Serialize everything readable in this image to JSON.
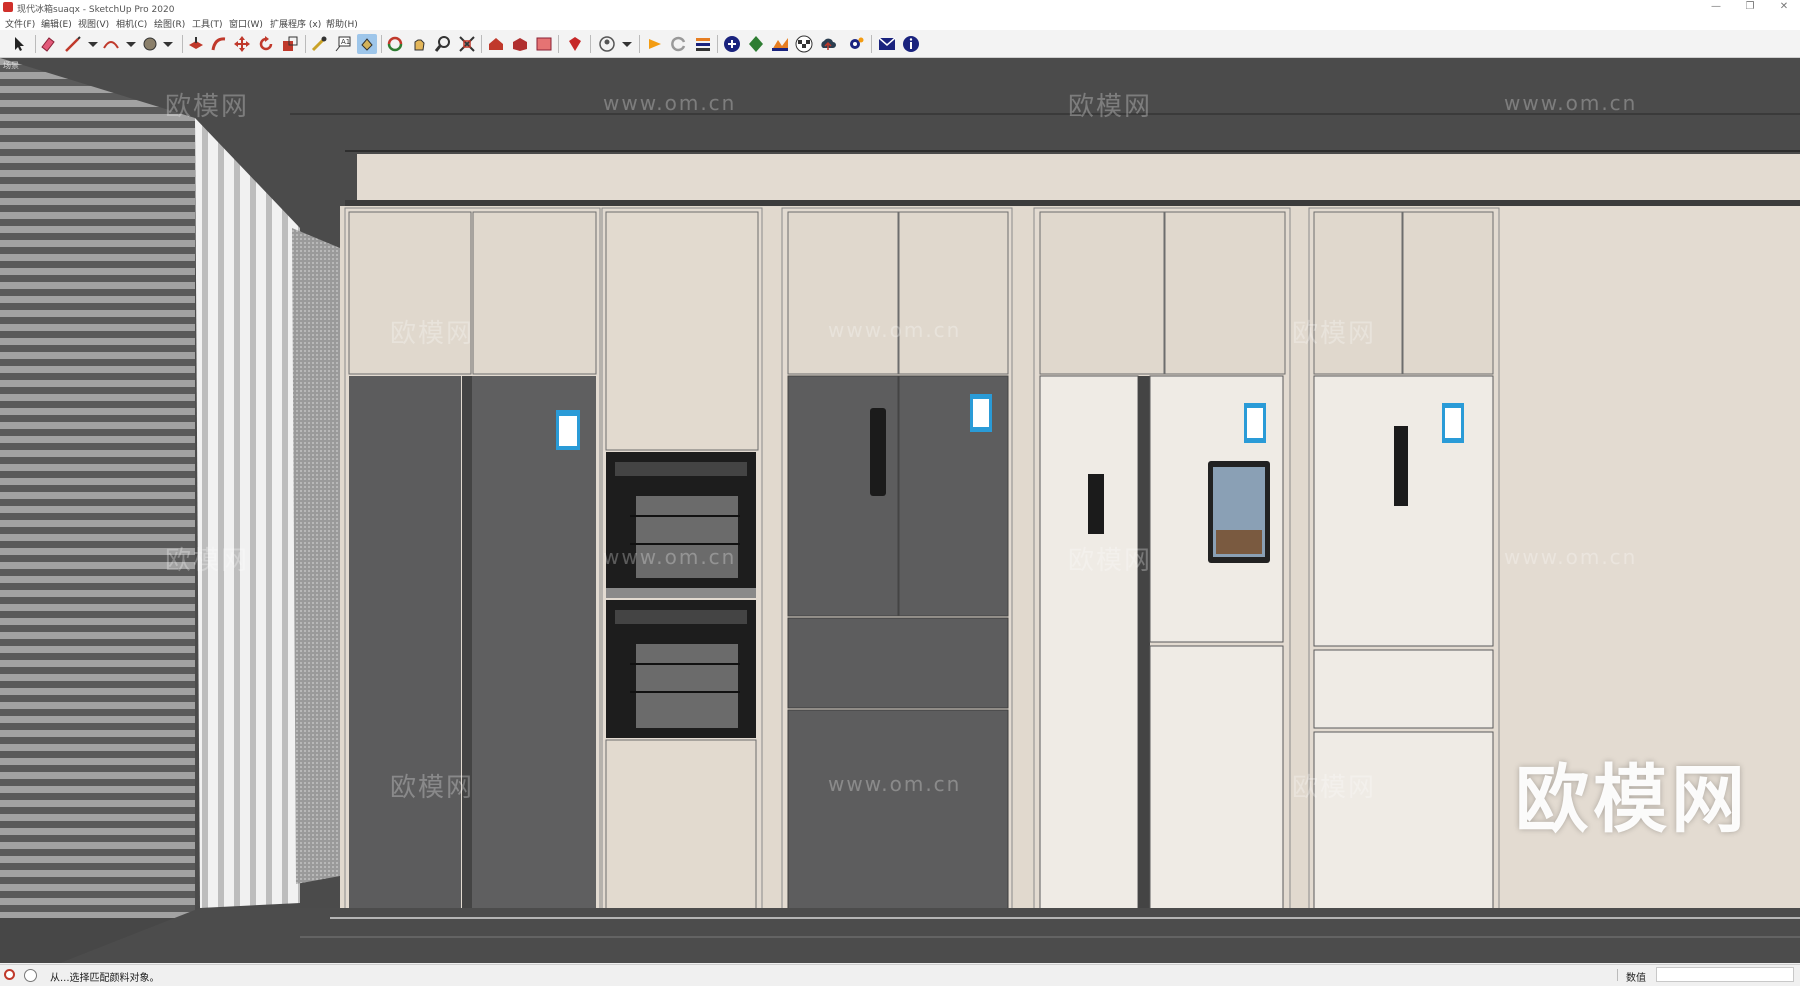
{
  "window": {
    "title": "现代冰箱.skp - SketchUp Pro 2020",
    "title_visible": "现代冰箱suaqx - SketchUp Pro 2020",
    "controls": [
      "—",
      "❐",
      "✕"
    ]
  },
  "menu": [
    "文件(F)",
    "编辑(E)",
    "视图(V)",
    "相机(C)",
    "绘图(R)",
    "工具(T)",
    "窗口(W)",
    "扩展程序 (x)",
    "帮助(H)"
  ],
  "toolbar": {
    "icons": [
      "select-icon",
      "eraser-icon",
      "line-icon",
      "arc-icon",
      "shape-icon",
      "push-pull-icon",
      "follow-me-icon",
      "move-icon",
      "rotate-icon",
      "scale-icon",
      "tape-measure-icon",
      "text-icon",
      "paint-bucket-icon",
      "orbit-icon",
      "pan-icon",
      "zoom-icon",
      "zoom-extents-icon",
      "warehouse-icon",
      "extension-warehouse-icon",
      "layout-icon",
      "ruby-icon",
      "account-icon",
      "add-location-icon",
      "refresh-icon",
      "sandbox-icon",
      "add-icon",
      "tree-icon",
      "terrain-icon",
      "checker-icon",
      "cloud-icon",
      "settings-icon",
      "mail-icon",
      "info-icon"
    ]
  },
  "viewport": {
    "scene_tab": "场景",
    "watermark_text": "欧模网",
    "watermark_url": "www.om.cn",
    "big_watermark": "欧模网"
  },
  "status": {
    "message": "从...选择匹配颜料对象。",
    "vcb_label": "数值",
    "vcb_value": ""
  },
  "colors": {
    "cabinet_beige": "#e3dbd1",
    "fridge_dark": "#5d5d5e",
    "fridge_white": "#efebe5",
    "wall_back": "#4b4b4b",
    "floor": "#4a4a4a"
  }
}
